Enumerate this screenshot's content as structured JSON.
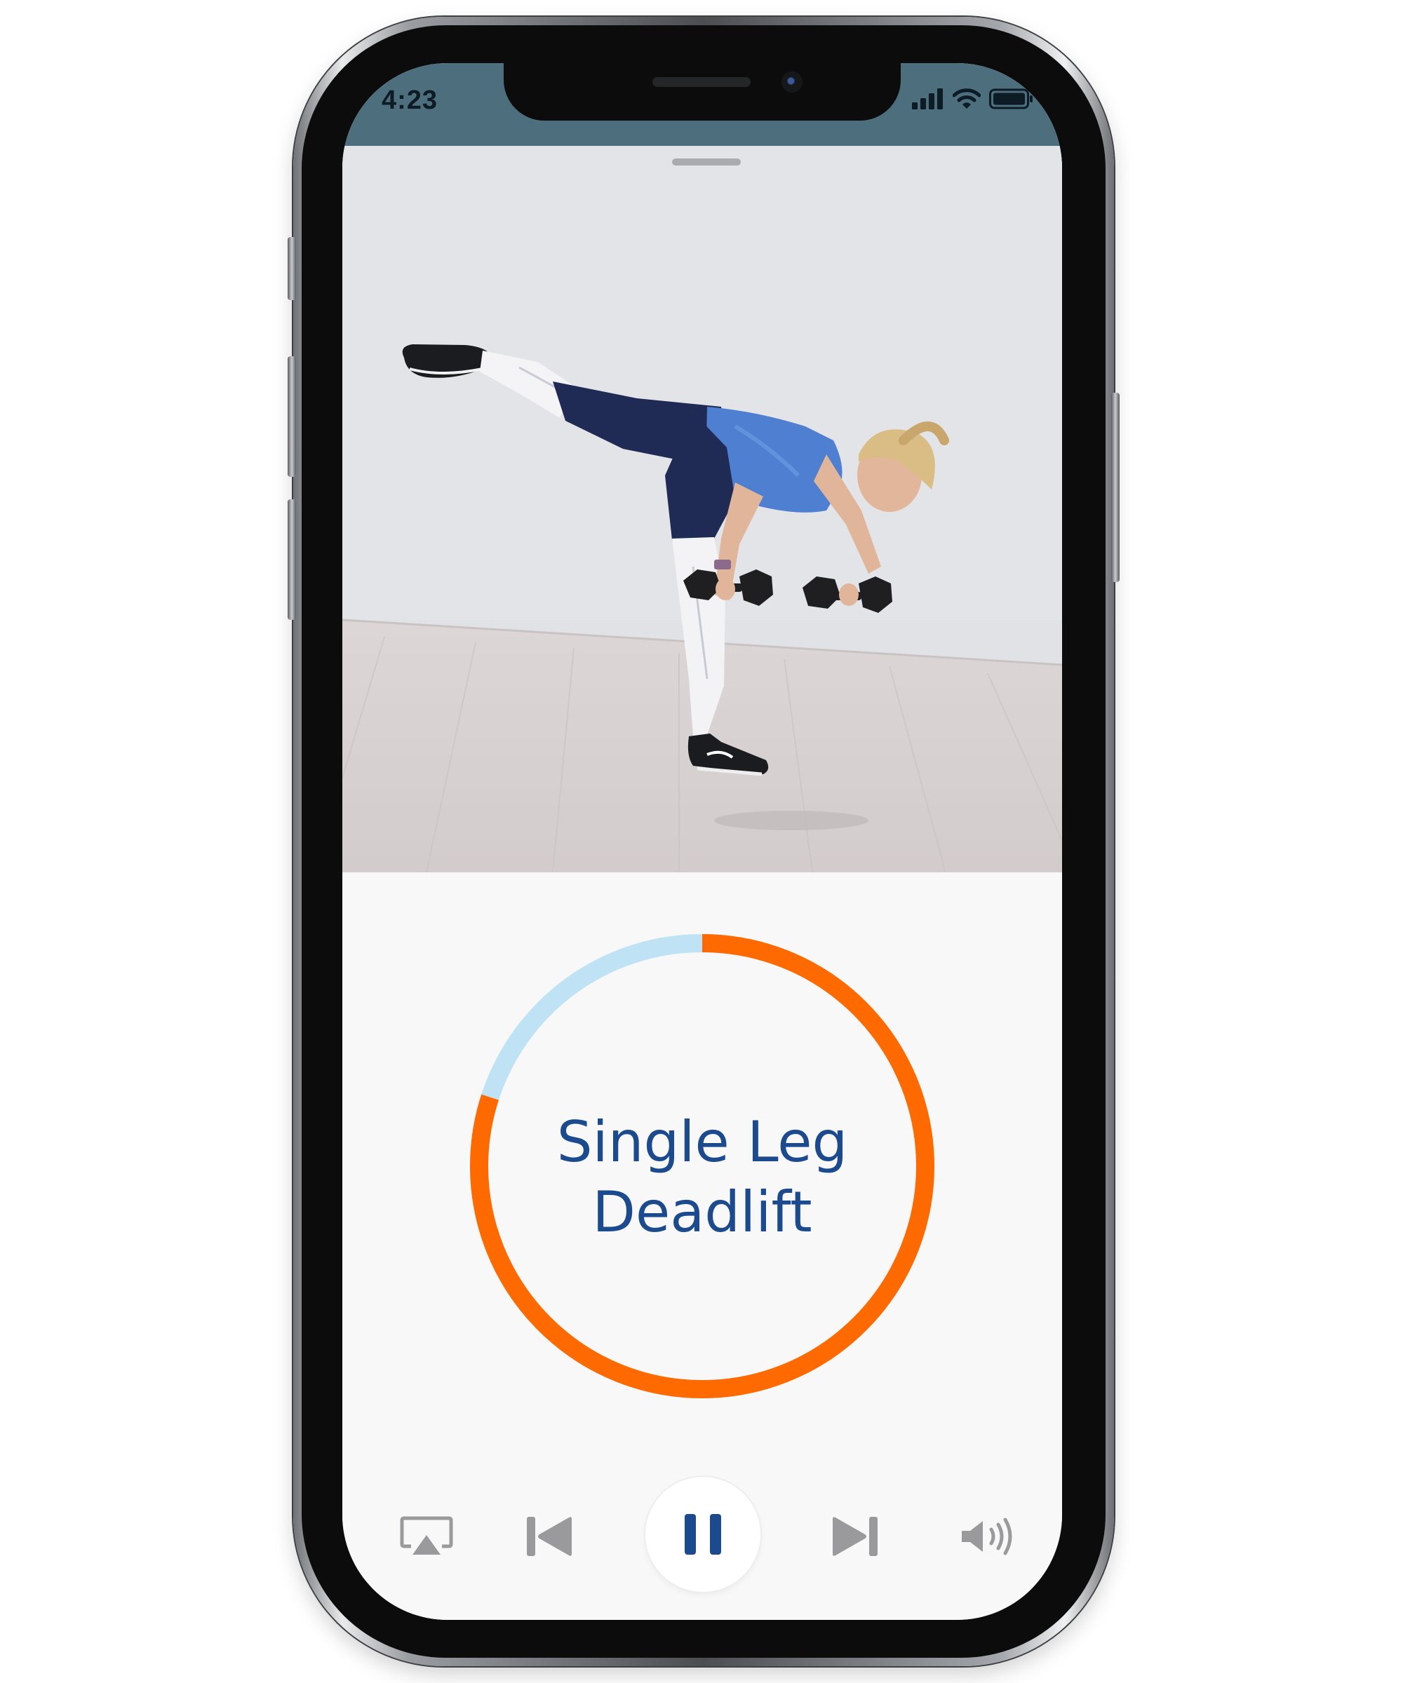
{
  "status_bar": {
    "time": "4:23",
    "background": "#4d6e7d"
  },
  "video": {
    "description_icon": "exercise-demo-video-frame"
  },
  "exercise": {
    "title_line_1": "Single Leg",
    "title_line_2": "Deadlift",
    "title_color": "#1c4a8f"
  },
  "timer": {
    "progress_fraction": 0.8,
    "elapsed_color": "#ff6a00",
    "remaining_color": "#bfe3f5"
  },
  "controls": {
    "airplay_icon": "airplay-icon",
    "previous_icon": "skip-previous-icon",
    "pause_icon": "pause-icon",
    "next_icon": "skip-next-icon",
    "volume_icon": "volume-icon",
    "icon_color": "#9a9a9c",
    "pause_color": "#1c4a8f"
  }
}
